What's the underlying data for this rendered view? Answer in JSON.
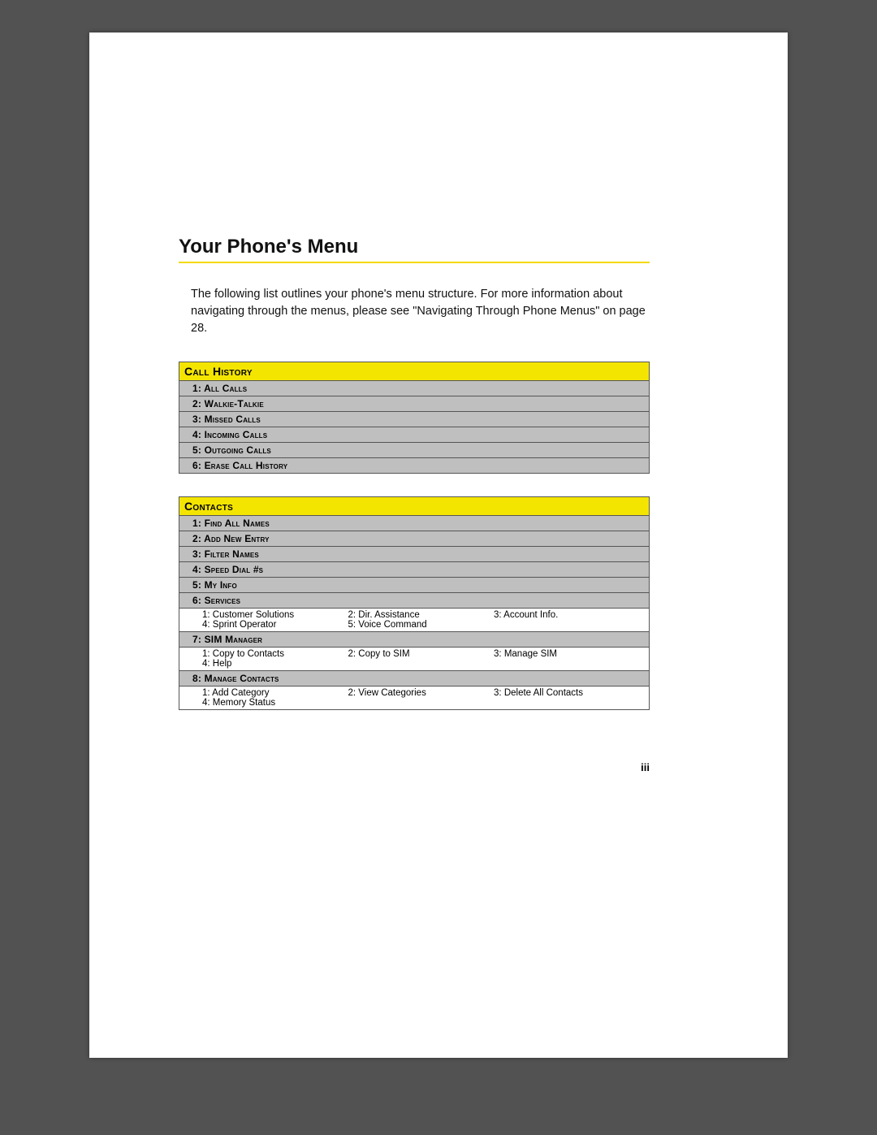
{
  "title": "Your Phone's Menu",
  "intro": "The following list outlines your phone's menu structure. For more information about navigating through the menus, please see \"Navigating Through Phone Menus\" on page 28.",
  "pageNumber": "iii",
  "sections": [
    {
      "header": "Call History",
      "items": [
        {
          "label": "1: All Calls"
        },
        {
          "label": "2: Walkie-Talkie"
        },
        {
          "label": "3: Missed Calls"
        },
        {
          "label": "4: Incoming Calls"
        },
        {
          "label": "5: Outgoing Calls"
        },
        {
          "label": "6: Erase Call History"
        }
      ]
    },
    {
      "header": "Contacts",
      "items": [
        {
          "label": "1: Find All Names"
        },
        {
          "label": "2: Add New Entry"
        },
        {
          "label": "3: Filter Names"
        },
        {
          "label": "4: Speed Dial #s"
        },
        {
          "label": "5: My Info"
        },
        {
          "label": "6: Services",
          "sub": [
            "1: Customer Solutions",
            "2: Dir. Assistance",
            "3: Account Info.",
            "4: Sprint Operator",
            "5: Voice Command",
            ""
          ]
        },
        {
          "label": "7: SIM Manager",
          "sub": [
            "1: Copy to Contacts",
            "2: Copy to SIM",
            "3: Manage SIM",
            "4: Help",
            "",
            ""
          ]
        },
        {
          "label": "8: Manage Contacts",
          "sub": [
            "1: Add Category",
            "2: View Categories",
            "3: Delete All Contacts",
            "4: Memory Status",
            "",
            ""
          ]
        }
      ]
    }
  ]
}
